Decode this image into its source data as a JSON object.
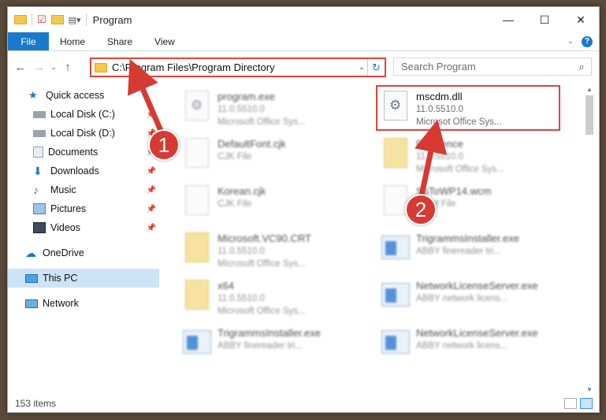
{
  "window": {
    "title": "Program",
    "controls": {
      "minimize": "—",
      "maximize": "☐",
      "close": "✕"
    }
  },
  "ribbon": {
    "file_tab": "File",
    "tabs": [
      "Home",
      "Share",
      "View"
    ],
    "help": "?"
  },
  "navigation": {
    "address_path": "C:\\Program Files\\Program Directory",
    "search_placeholder": "Search Program"
  },
  "sidebar": {
    "items": [
      {
        "label": "Quick access",
        "icon": "star-icon",
        "pinned": false
      },
      {
        "label": "Local Disk (C:)",
        "icon": "drive-icon",
        "pinned": true
      },
      {
        "label": "Local Disk (D:)",
        "icon": "drive-icon",
        "pinned": true
      },
      {
        "label": "Documents",
        "icon": "documents-icon",
        "pinned": true
      },
      {
        "label": "Downloads",
        "icon": "download-icon",
        "pinned": true
      },
      {
        "label": "Music",
        "icon": "music-icon",
        "pinned": true
      },
      {
        "label": "Pictures",
        "icon": "pictures-icon",
        "pinned": true
      },
      {
        "label": "Videos",
        "icon": "videos-icon",
        "pinned": true
      },
      {
        "label": "OneDrive",
        "icon": "onedrive-icon",
        "pinned": false
      },
      {
        "label": "This PC",
        "icon": "pc-icon",
        "pinned": false
      },
      {
        "label": "Network",
        "icon": "network-icon",
        "pinned": false
      }
    ]
  },
  "files": [
    {
      "name": "program.exe",
      "line2": "11.0.5510.0",
      "line3": "Microsoft Office Sys...",
      "kind": "gear"
    },
    {
      "name": "mscdm.dll",
      "line2": "11.0.5510.0",
      "line3": "Microsot Office Sys...",
      "kind": "gear"
    },
    {
      "name": "DefaultFont.cjk",
      "line2": "CJK File",
      "line3": "",
      "kind": "doc"
    },
    {
      "name": "Reference",
      "line2": "11.0.5510.0",
      "line3": "Microsoft Office Sys...",
      "kind": "folder"
    },
    {
      "name": "Korean.cjk",
      "line2": "CJK File",
      "line3": "",
      "kind": "doc"
    },
    {
      "name": "SbToWP14.wcm",
      "line2": "WCM File",
      "line3": "",
      "kind": "doc"
    },
    {
      "name": "Microsoft.VC90.CRT",
      "line2": "11.0.5510.0",
      "line3": "Microsoft Office Sys...",
      "kind": "folder"
    },
    {
      "name": "TrigrammsInstaller.exe",
      "line2": "ABBY finereader tri...",
      "line3": "",
      "kind": "exe"
    },
    {
      "name": "x64",
      "line2": "11.0.5510.0",
      "line3": "Microsoft Office Sys...",
      "kind": "folder"
    },
    {
      "name": "NetworkLicenseServer.exe",
      "line2": "ABBY network licens...",
      "line3": "",
      "kind": "exe"
    },
    {
      "name": "TrigrammsInstaller.exe",
      "line2": "ABBY finereader tri...",
      "line3": "",
      "kind": "exe"
    },
    {
      "name": "NetworkLicenseServer.exe",
      "line2": "ABBY network licens...",
      "line3": "",
      "kind": "exe"
    }
  ],
  "callouts": [
    "1",
    "2"
  ],
  "status": {
    "item_count": "153 items"
  },
  "colors": {
    "accent": "#1979ca",
    "highlight": "#e0433b",
    "selected": "#cce4f7"
  }
}
